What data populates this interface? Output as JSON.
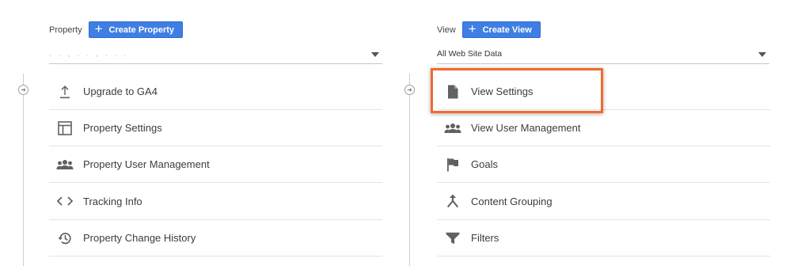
{
  "property": {
    "header_label": "Property",
    "create_button": "Create Property",
    "selector_value": ". . , . . , . . ."
  },
  "view": {
    "header_label": "View",
    "create_button": "Create View",
    "selector_value": "All Web Site Data"
  },
  "property_menu": [
    {
      "label": "Upgrade to GA4",
      "icon": "upload-icon"
    },
    {
      "label": "Property Settings",
      "icon": "layout-icon"
    },
    {
      "label": "Property User Management",
      "icon": "people-icon"
    },
    {
      "label": "Tracking Info",
      "icon": "code-icon"
    },
    {
      "label": "Property Change History",
      "icon": "history-icon"
    }
  ],
  "view_menu": [
    {
      "label": "View Settings",
      "icon": "document-icon",
      "highlighted": true
    },
    {
      "label": "View User Management",
      "icon": "people-icon"
    },
    {
      "label": "Goals",
      "icon": "flag-icon"
    },
    {
      "label": "Content Grouping",
      "icon": "merge-icon"
    },
    {
      "label": "Filters",
      "icon": "filter-icon"
    }
  ],
  "colors": {
    "button_blue": "#3f7fe3",
    "highlight_orange": "#f26a2e",
    "icon_gray": "#616161"
  }
}
